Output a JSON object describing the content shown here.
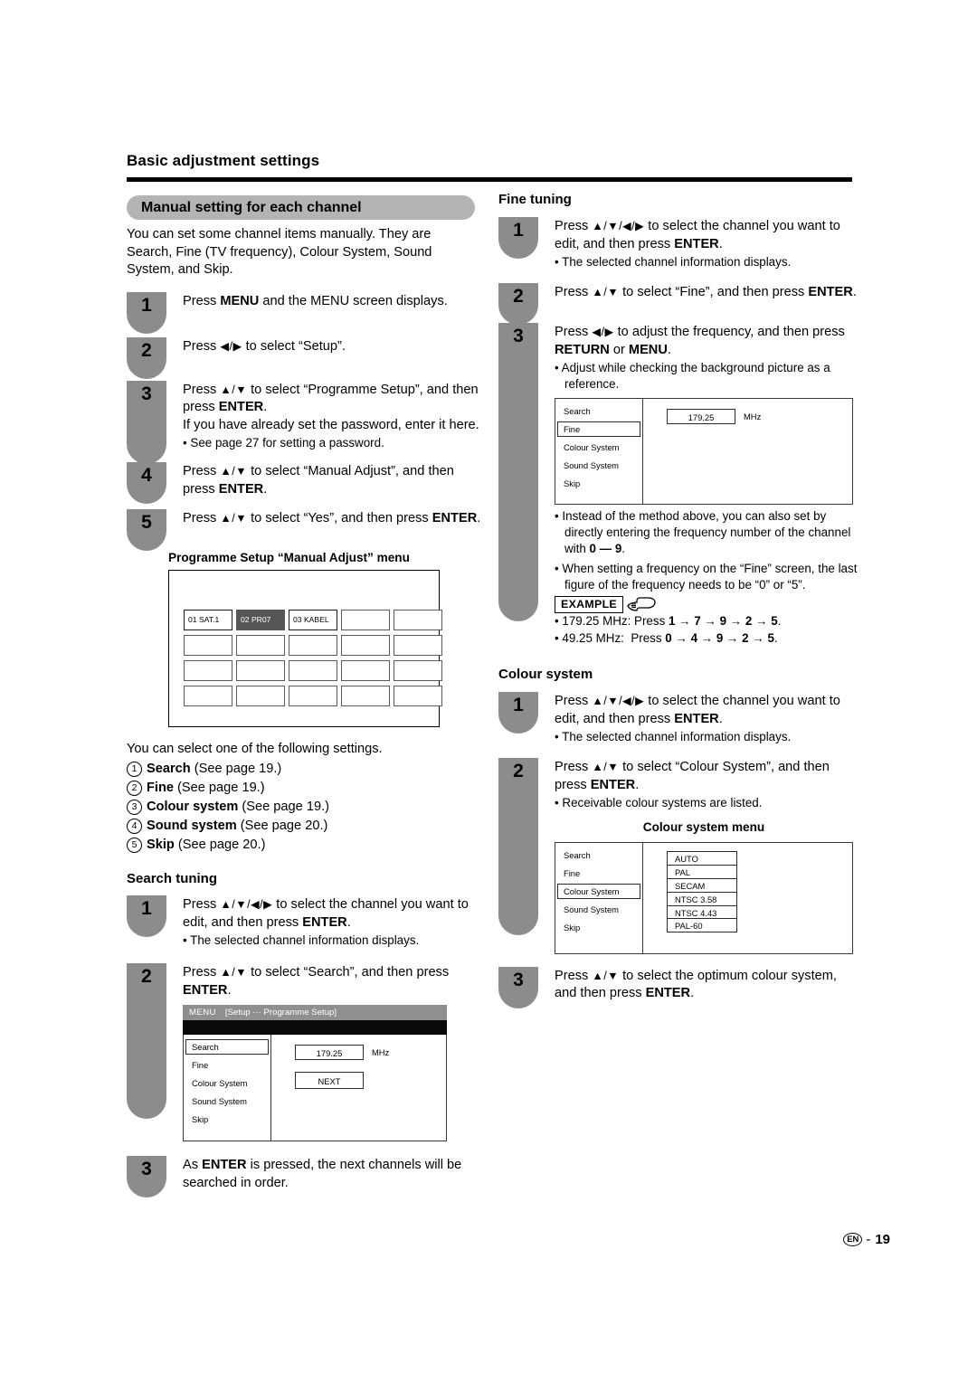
{
  "header": {
    "chapter_title": "Basic adjustment settings",
    "section_title": "Manual setting for each channel"
  },
  "left_column": {
    "intro": "You can set some channel items manually. They are Search, Fine (TV frequency), Colour System, Sound System, and Skip.",
    "steps": [
      {
        "number": "1",
        "text_html": "Press <b>MENU</b> and the MENU screen displays."
      },
      {
        "number": "2",
        "text_html": "Press <span class=\"arrows\">◀/▶</span> to select “Setup”."
      },
      {
        "number": "3",
        "text_html": "Press <span class=\"arrows\">▲/▼</span> to select “Programme Setup”, and then press <b>ENTER</b>.<br>If you have already set the password, enter it here.",
        "bullets": [
          "See page 27 for setting a password."
        ]
      },
      {
        "number": "4",
        "text_html": "Press <span class=\"arrows\">▲/▼</span> to select “Manual Adjust”, and then press <b>ENTER</b>."
      },
      {
        "number": "5",
        "text_html": "Press <span class=\"arrows\">▲/▼</span> to select “Yes”, and then press <b>ENTER</b>."
      }
    ],
    "manual_adjust_diagram": {
      "caption": "Programme Setup “Manual Adjust” menu",
      "columns": 5,
      "rows": 4,
      "cells": [
        "01  SAT.1",
        "02  PR07",
        "03  KABEL",
        "",
        "",
        "",
        "",
        "",
        "",
        "",
        "",
        "",
        "",
        "",
        "",
        "",
        "",
        "",
        "",
        ""
      ],
      "selected_index": 1
    },
    "settings_lead": "You can select one of the following settings.",
    "settings_list": [
      {
        "num": "1",
        "name": "Search",
        "ref": "(See page 19.)"
      },
      {
        "num": "2",
        "name": "Fine",
        "ref": "(See page 19.)"
      },
      {
        "num": "3",
        "name": "Colour system",
        "ref": "(See page 19.)"
      },
      {
        "num": "4",
        "name": "Sound system",
        "ref": "(See page 20.)"
      },
      {
        "num": "5",
        "name": "Skip",
        "ref": "(See page 20.)"
      }
    ],
    "search_tuning": {
      "heading": "Search tuning",
      "steps": [
        {
          "number": "1",
          "text_html": "Press <span class=\"arrows\">▲/▼/◀/▶</span> to select the channel you want to edit, and then press <b>ENTER</b>.",
          "bullets": [
            "The selected channel information displays."
          ]
        },
        {
          "number": "2",
          "text_html": "Press <span class=\"arrows\">▲/▼</span> to select “Search”, and then press <b>ENTER</b>."
        },
        {
          "number": "3",
          "text_html": "As <b>ENTER</b> is pressed, the next channels will be searched in order."
        }
      ],
      "osd": {
        "titlebar_menu": "MENU",
        "titlebar_path": "[Setup ··· Programme Setup]",
        "items": [
          "Search",
          "Fine",
          "Colour System",
          "Sound System",
          "Skip"
        ],
        "selected_item": "Search",
        "frequency_value": "179.25",
        "frequency_unit": "MHz",
        "next_button": "NEXT"
      }
    }
  },
  "right_column": {
    "fine_tuning": {
      "heading": "Fine tuning",
      "steps": [
        {
          "number": "1",
          "text_html": "Press <span class=\"arrows\">▲/▼/◀/▶</span> to select the channel you want to edit, and then press <b>ENTER</b>.",
          "bullets": [
            "The selected channel information displays."
          ]
        },
        {
          "number": "2",
          "text_html": "Press <span class=\"arrows\">▲/▼</span> to select “Fine”, and then press <b>ENTER</b>."
        },
        {
          "number": "3",
          "text_html": "Press <span class=\"arrows\">◀/▶</span> to adjust the frequency, and then press <b>RETURN</b> or <b>MENU</b>.",
          "bullets": [
            "Adjust while checking the background picture as a reference."
          ]
        }
      ],
      "osd": {
        "items": [
          "Search",
          "Fine",
          "Colour System",
          "Sound System",
          "Skip"
        ],
        "selected_item": "Fine",
        "frequency_value": "179.25",
        "frequency_unit": "MHz"
      },
      "notes": [
        "Instead of the method above, you can also set by directly entering the frequency number of the channel with <b>0 — 9</b>.",
        "When setting a frequency on the “Fine” screen, the last figure of the frequency needs to be “0” or “5”."
      ],
      "example_label": "EXAMPLE",
      "examples": [
        "179.25 MHz: Press <b>1</b> → <b>7</b> → <b>9</b> → <b>2</b> → <b>5</b>.",
        "49.25 MHz:&nbsp; Press <b>0</b> → <b>4</b> → <b>9</b> → <b>2</b> → <b>5</b>."
      ]
    },
    "colour_system": {
      "heading": "Colour system",
      "steps": [
        {
          "number": "1",
          "text_html": "Press <span class=\"arrows\">▲/▼/◀/▶</span> to select the channel you want to edit, and then press <b>ENTER</b>.",
          "bullets": [
            "The selected channel information displays."
          ]
        },
        {
          "number": "2",
          "text_html": "Press <span class=\"arrows\">▲/▼</span> to select “Colour System”, and then press <b>ENTER</b>.",
          "bullets": [
            "Receivable colour systems are listed."
          ]
        },
        {
          "number": "3",
          "text_html": "Press <span class=\"arrows\">▲/▼</span> to select the optimum colour system, and then press <b>ENTER</b>."
        }
      ],
      "diagram_caption": "Colour system menu",
      "osd": {
        "items": [
          "Search",
          "Fine",
          "Colour System",
          "Sound System",
          "Skip"
        ],
        "selected_item": "Colour System",
        "options": [
          "AUTO",
          "PAL",
          "SECAM",
          "NTSC 3.58",
          "NTSC 4.43",
          "PAL-60"
        ]
      }
    }
  },
  "footer": {
    "lang_badge": "EN",
    "dash": "-",
    "page_number": "19"
  },
  "colors": {
    "badge_gray": "#8c8c8c",
    "pill_gray": "#b4b4b4",
    "osd_titlebar_gray": "#8f8f8f",
    "osd_black": "#0a0a0a",
    "grid_selected": "#565656"
  }
}
